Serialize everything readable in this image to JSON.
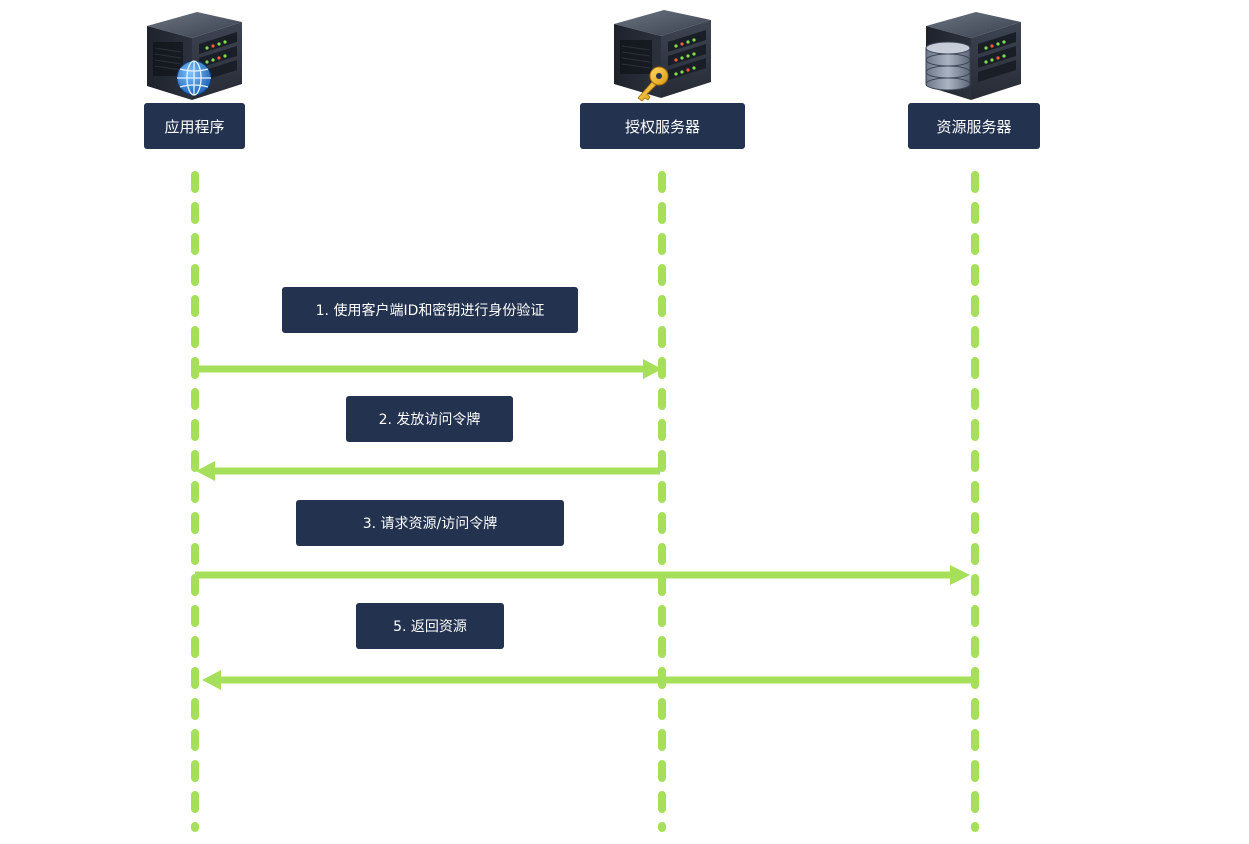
{
  "participants": [
    {
      "id": "app",
      "label": "应用程序",
      "icon": "globe-server-icon"
    },
    {
      "id": "auth",
      "label": "授权服务器",
      "icon": "key-server-icon"
    },
    {
      "id": "resource",
      "label": "资源服务器",
      "icon": "database-server-icon"
    }
  ],
  "messages": [
    {
      "label": "1. 使用客户端ID和密钥进行身份验证",
      "from": "app",
      "to": "auth"
    },
    {
      "label": "2. 发放访问令牌",
      "from": "auth",
      "to": "app"
    },
    {
      "label": "3. 请求资源/访问令牌",
      "from": "app",
      "to": "resource"
    },
    {
      "label": "5. 返回资源",
      "from": "resource",
      "to": "app"
    }
  ],
  "colors": {
    "lifeline": "#a6e05a",
    "arrow": "#a6e05a",
    "label_bg": "#22324f",
    "label_text": "#ffffff"
  }
}
